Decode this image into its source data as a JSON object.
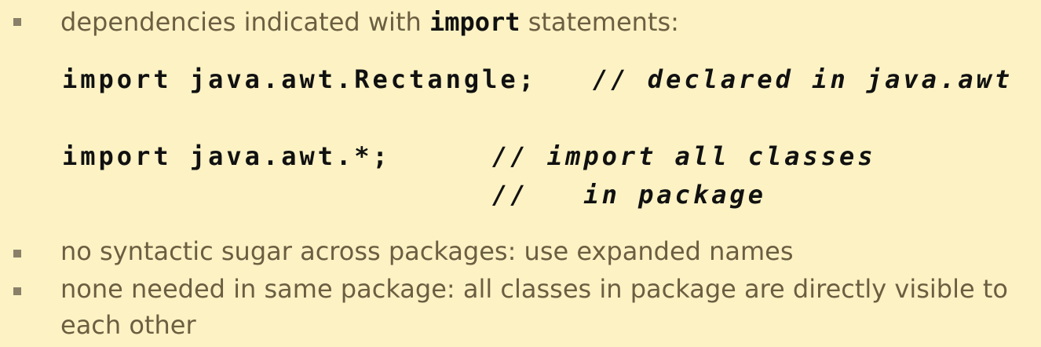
{
  "bullets": [
    {
      "before": "dependencies indicated with ",
      "keyword": "import",
      "after": " statements:"
    },
    {
      "text": "no syntactic sugar across packages: use expanded names"
    },
    {
      "line1": "none needed in same package: all classes in package are directly visible to",
      "line2": "each other"
    }
  ],
  "code": {
    "line1": {
      "code": "import java.awt.Rectangle;",
      "comment": "// declared in java.awt"
    },
    "line2": {
      "code": "import java.awt.*;",
      "comment": "// import all classes"
    },
    "line3": {
      "comment": "//   in package"
    }
  }
}
